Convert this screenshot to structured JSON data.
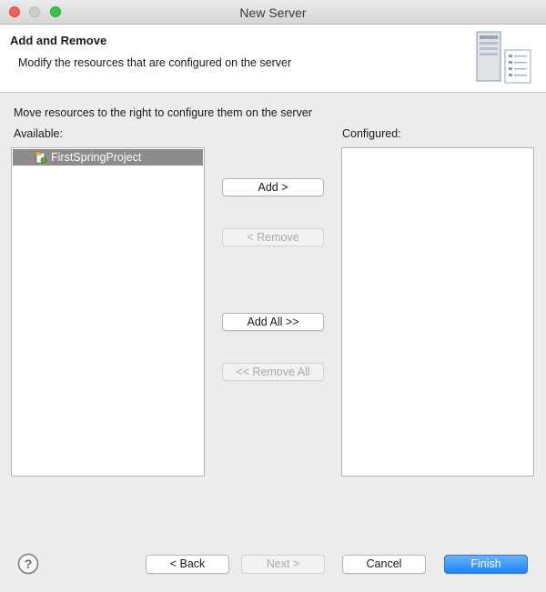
{
  "window": {
    "title": "New Server"
  },
  "banner": {
    "title": "Add and Remove",
    "description": "Modify the resources that are configured on the server",
    "icon": "server-icon"
  },
  "content": {
    "instructions": "Move resources to the right to configure them on the server",
    "available_label": "Available:",
    "configured_label": "Configured:",
    "available_items": [
      {
        "label": "FirstSpringProject",
        "selected": true,
        "icon": "project-icon"
      }
    ],
    "configured_items": []
  },
  "actions": {
    "add": "Add >",
    "remove": "< Remove",
    "add_all": "Add All >>",
    "remove_all": "<< Remove All"
  },
  "footer": {
    "help_icon": "help-icon",
    "back": "< Back",
    "next": "Next >",
    "cancel": "Cancel",
    "finish": "Finish"
  },
  "colors": {
    "selection": "#8c8c8c",
    "finish_button": "#1a82fb",
    "close_light": "#fc5f57",
    "zoom_light": "#33c748"
  }
}
